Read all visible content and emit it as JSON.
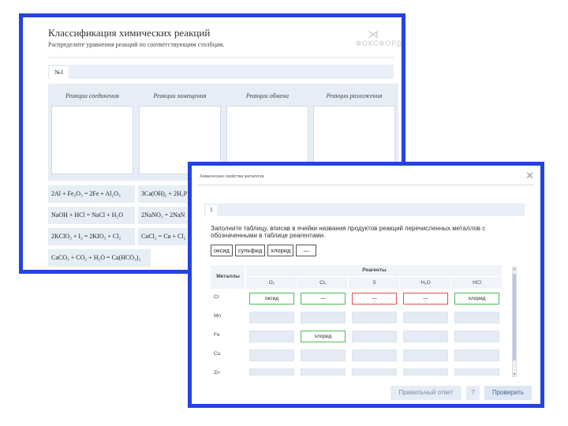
{
  "back_window": {
    "title": "Классификация химических реакций",
    "subtitle": "Распределите уравнения реакций по соответствующим столбцам.",
    "logo_text": "ФОКСФОРД",
    "tab_label": "№1",
    "columns": [
      "Реакции соединения",
      "Реакции замещения",
      "Реакции обмена",
      "Реакции разложения"
    ],
    "chips": [
      "2Al + Fe₂O₃ = 2Fe + Al₂O₃",
      "3Ca(OH)₂ + 2H₃P",
      "NaOH + HCl = NaCl + H₂O",
      "2NaNO₃ = 2NaN",
      "2KClO₃ + I₂ = 2KIO₃ + Cl₂",
      "CuCl₂ = Cu + Cl₂",
      "CaCO₃ + CO₂ + H₂O = Ca(HCO₃)₂"
    ]
  },
  "dialog": {
    "title": "Химические свойства металлов",
    "close_icon": "close-icon",
    "question_number": "1",
    "instruction": "Заполните таблицу, вписав в ячейки названия продуктов реакций перечисленных металлов с обозначенными в таблице реагентами.",
    "word_bank": [
      "оксид",
      "сульфид",
      "хлорид",
      "—"
    ],
    "table": {
      "corner_header": "Металлы",
      "group_header": "Реагенты",
      "reagents": [
        "O₂",
        "Cl₂",
        "S",
        "H₂O",
        "HCl"
      ],
      "rows": [
        {
          "metal": "Cr",
          "cells": [
            {
              "value": "оксид",
              "state": "correct"
            },
            {
              "value": "—",
              "state": "correct"
            },
            {
              "value": "—",
              "state": "wrong"
            },
            {
              "value": "—",
              "state": "wrong"
            },
            {
              "value": "хлорид",
              "state": "correct"
            }
          ]
        },
        {
          "metal": "Mn",
          "cells": [
            {
              "value": "",
              "state": "empty"
            },
            {
              "value": "",
              "state": "empty"
            },
            {
              "value": "",
              "state": "empty"
            },
            {
              "value": "",
              "state": "empty"
            },
            {
              "value": "",
              "state": "empty"
            }
          ]
        },
        {
          "metal": "Fe",
          "cells": [
            {
              "value": "",
              "state": "empty"
            },
            {
              "value": "хлорид",
              "state": "correct"
            },
            {
              "value": "",
              "state": "empty"
            },
            {
              "value": "",
              "state": "empty"
            },
            {
              "value": "",
              "state": "empty"
            }
          ]
        },
        {
          "metal": "Cu",
          "cells": [
            {
              "value": "",
              "state": "empty"
            },
            {
              "value": "",
              "state": "empty"
            },
            {
              "value": "",
              "state": "empty"
            },
            {
              "value": "",
              "state": "empty"
            },
            {
              "value": "",
              "state": "empty"
            }
          ]
        },
        {
          "metal": "Zn",
          "cells": [
            {
              "value": "",
              "state": "empty"
            },
            {
              "value": "",
              "state": "empty"
            },
            {
              "value": "",
              "state": "empty"
            },
            {
              "value": "",
              "state": "empty"
            },
            {
              "value": "",
              "state": "empty"
            }
          ]
        }
      ]
    },
    "buttons": {
      "correct_answer": "Правильный ответ",
      "help": "?",
      "check": "Проверить"
    }
  },
  "colors": {
    "window_border": "#2443e0",
    "correct_border": "#4cbb5c",
    "wrong_border": "#e0504c",
    "panel_bg": "#e7edf5"
  }
}
